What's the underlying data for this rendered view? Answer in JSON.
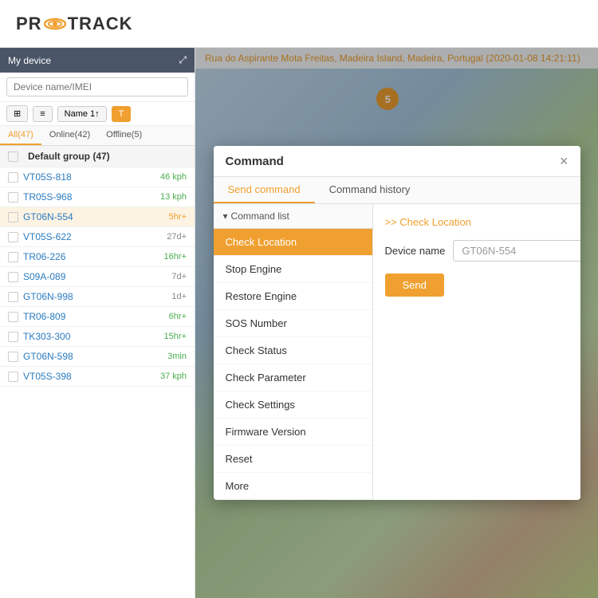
{
  "app": {
    "title": "PROTRACK"
  },
  "header": {
    "logo_text_before": "PR",
    "logo_text_after": "TRACK"
  },
  "sidebar": {
    "title": "My device",
    "search_placeholder": "Device name/IMEI",
    "tabs": [
      {
        "label": "All(47)",
        "active": true
      },
      {
        "label": "Online(42)",
        "active": false
      },
      {
        "label": "Offline(5)",
        "active": false
      }
    ],
    "toolbar": {
      "btn1": "⊞",
      "btn2": "≡",
      "btn3": "Name 1↑",
      "btn4": "T"
    },
    "group": "Default group (47)",
    "devices": [
      {
        "name": "VT05S-818",
        "status": "46 kph",
        "status_class": "online"
      },
      {
        "name": "TR05S-968",
        "status": "13 kph",
        "status_class": "online"
      },
      {
        "name": "GT06N-554",
        "status": "5hr+",
        "status_class": "orange",
        "selected": true
      },
      {
        "name": "VT05S-622",
        "status": "27d+",
        "status_class": ""
      },
      {
        "name": "TR06-226",
        "status": "16hr+",
        "status_class": "online"
      },
      {
        "name": "S09A-089",
        "status": "7d+",
        "status_class": ""
      },
      {
        "name": "GT06N-998",
        "status": "1d+",
        "status_class": ""
      },
      {
        "name": "TR06-809",
        "status": "6hr+",
        "status_class": "online"
      },
      {
        "name": "TK303-300",
        "status": "15hr+",
        "status_class": "online"
      },
      {
        "name": "GT06N-598",
        "status": "3min",
        "status_class": "online"
      },
      {
        "name": "VT05S-398",
        "status": "37 kph",
        "status_class": "online"
      }
    ]
  },
  "map": {
    "address": "Rua do Aspirante Mota Freitas, Madeira Island, Madeira, Portugal",
    "timestamp": "(2020-01-08 14:21:11)",
    "cluster_count": "5"
  },
  "dialog": {
    "title": "Command",
    "close_btn": "×",
    "tabs": [
      {
        "label": "Send command",
        "active": true
      },
      {
        "label": "Command history",
        "active": false
      }
    ],
    "cmd_list_header": "Command list",
    "cmd_link": ">> Check Location",
    "commands": [
      {
        "label": "Check Location",
        "selected": true
      },
      {
        "label": "Stop Engine",
        "selected": false
      },
      {
        "label": "Restore Engine",
        "selected": false
      },
      {
        "label": "SOS Number",
        "selected": false
      },
      {
        "label": "Check Status",
        "selected": false
      },
      {
        "label": "Check Parameter",
        "selected": false
      },
      {
        "label": "Check Settings",
        "selected": false
      },
      {
        "label": "Firmware Version",
        "selected": false
      },
      {
        "label": "Reset",
        "selected": false
      },
      {
        "label": "More",
        "selected": false
      }
    ],
    "device_name_label": "Device name",
    "device_name_value": "GT06N-554",
    "send_btn": "Send"
  }
}
